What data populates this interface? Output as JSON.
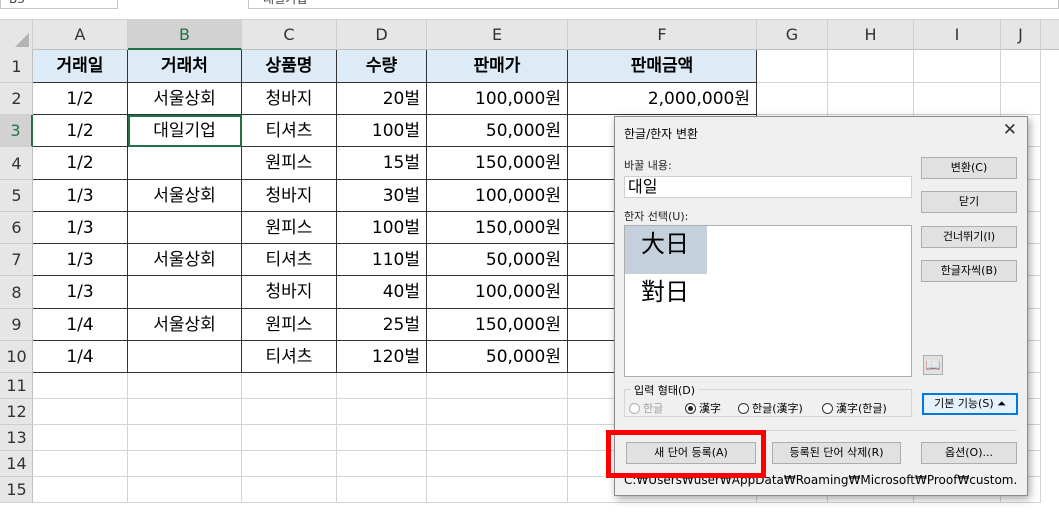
{
  "toolbar": {
    "namebox": "B3",
    "formula": "대일기업"
  },
  "columns": [
    "A",
    "B",
    "C",
    "D",
    "E",
    "F",
    "G",
    "H",
    "I",
    "J"
  ],
  "rows": [
    "1",
    "2",
    "3",
    "4",
    "5",
    "6",
    "7",
    "8",
    "9",
    "10",
    "11",
    "12",
    "13",
    "14",
    "15"
  ],
  "table": {
    "headers": [
      "거래일",
      "거래처",
      "상품명",
      "수량",
      "판매가",
      "판매금액"
    ],
    "rows": [
      [
        "1/2",
        "서울상회",
        "청바지",
        "20벌",
        "100,000원",
        "2,000,000원"
      ],
      [
        "1/2",
        "대일기업",
        "티셔츠",
        "100벌",
        "50,000원",
        ""
      ],
      [
        "1/2",
        "",
        "원피스",
        "15벌",
        "150,000원",
        ""
      ],
      [
        "1/3",
        "서울상회",
        "청바지",
        "30벌",
        "100,000원",
        ""
      ],
      [
        "1/3",
        "",
        "원피스",
        "100벌",
        "150,000원",
        ""
      ],
      [
        "1/3",
        "서울상회",
        "티셔츠",
        "110벌",
        "50,000원",
        ""
      ],
      [
        "1/3",
        "",
        "청바지",
        "40벌",
        "100,000원",
        ""
      ],
      [
        "1/4",
        "서울상회",
        "원피스",
        "25벌",
        "150,000원",
        ""
      ],
      [
        "1/4",
        "",
        "티셔츠",
        "120벌",
        "50,000원",
        ""
      ]
    ]
  },
  "dialog": {
    "title": "한글/한자 변환",
    "source_label": "바꿀 내용:",
    "source_value": "대일",
    "list_label": "한자 선택(U):",
    "candidates": [
      "大日",
      "對日"
    ],
    "buttons": [
      "변환(C)",
      "닫기",
      "건너뛰기(I)",
      "한글자씩(B)"
    ],
    "input_form_label": "입력 형태(D)",
    "radios": [
      "한글",
      "漢字",
      "한글(漢字)",
      "漢字(한글)"
    ],
    "basic_button": "기본 기능(S) ⏶",
    "bottom_buttons": [
      "새 단어 등록(A)",
      "등록된 단어 삭제(R)",
      "옵션(O)..."
    ],
    "path": "C:₩Users₩user₩AppData₩Roaming₩Microsoft₩Proof₩custom.hhd"
  }
}
